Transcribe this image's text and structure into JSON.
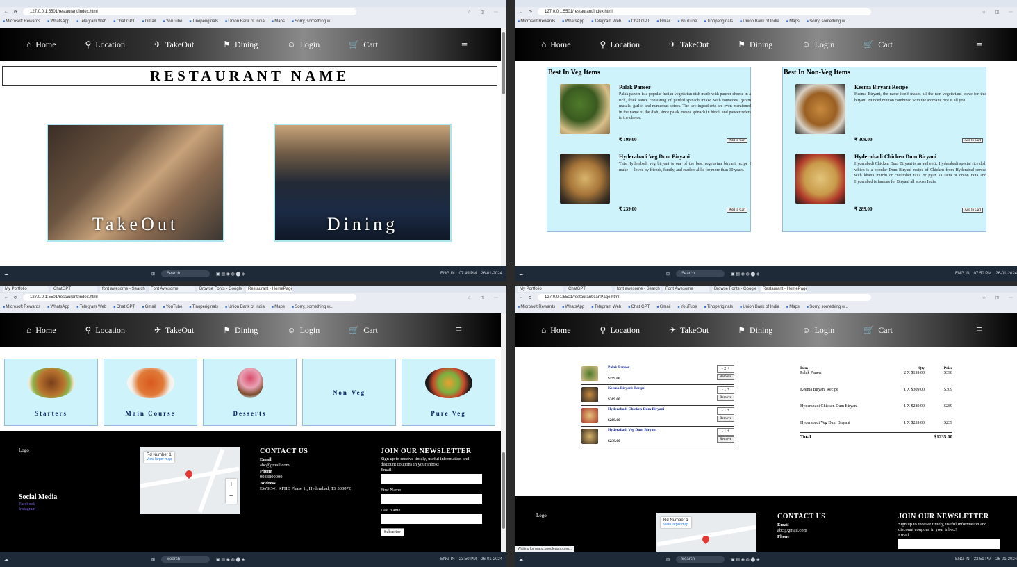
{
  "browser": {
    "url_home": "127.0.0.1:5501/restaurant/index.html",
    "url_cart": "127.0.0.1:5501/restaurant/cartPage.html",
    "bookmarks": [
      "Microsoft Rewards",
      "WhatsApp",
      "Telegram Web",
      "Chat GPT",
      "Gmail",
      "YouTube",
      "Tinoperiginals",
      "Union Bank of India",
      "Maps",
      "Sorry, something w..."
    ],
    "tabs": [
      "My Portfolio",
      "ChatGPT",
      "font awesome - Search",
      "Font Awesome",
      "Browse Fonts - Google F",
      "Restaurant - HomePage"
    ]
  },
  "nav": {
    "home": "Home",
    "location": "Location",
    "takeout": "TakeOut",
    "dining": "Dining",
    "login": "Login",
    "cart": "Cart",
    "menu_icon": "≡"
  },
  "home": {
    "restaurant_name": "RESTAURANT NAME",
    "takeout_label": "TakeOut",
    "dining_label": "Dining"
  },
  "menu": {
    "veg_title": "Best In Veg Items",
    "nonveg_title": "Best In Non-Veg Items",
    "add_label": "Add to Cart",
    "veg": [
      {
        "name": "Palak Paneer",
        "desc": "Palak paneer is a popular Indian vegetarian dish made with paneer cheese in a rich, thick sauce consisting of puréed spinach mixed with tomatoes, garam masala, garlic, and numerous spices. The key ingredients are even mentioned in the name of the dish, since palak means spinach in hindi, and paneer refers to the cheese.",
        "price": "₹ 199.00"
      },
      {
        "name": "Hyderabadi Veg Dum Biryani",
        "desc": "This Hyderabadi veg biryani is one of the best vegetarian biryani recipe I make — loved by friends, family, and readers alike for more than 10 years.",
        "price": "₹ 239.00"
      }
    ],
    "nonveg": [
      {
        "name": "Keema Biryani Recipe",
        "desc": "Keema Biryani, the name itself makes all the non vegetarians crave for this biryani. Minced mutton combined with the aromatic rice is all you!",
        "price": "₹ 309.00"
      },
      {
        "name": "Hyderabadi Chicken Dum Biryani",
        "desc": "Hyderabadi Chicken Dum Biryani is an authentic Hyderabadi special rice dish which is a popular Dum Biryani recipe of Chicken from Hyderabad served with khatta mirchi or cucumber raita or pyaz ka raita or onion raita and Hyderabad is famous for Biryani all across India.",
        "price": "₹ 289.00"
      }
    ]
  },
  "categories": [
    "Starters",
    "Main Course",
    "Desserts",
    "Non-Veg",
    "Pure Veg"
  ],
  "footer": {
    "logo": "Logo",
    "social_title": "Social Media",
    "social_links": [
      "Facebook",
      "Instagram"
    ],
    "map_place": "Rd Number 1",
    "map_link": "View larger map",
    "contact_title": "CONTACT US",
    "email_label": "Email",
    "email": "abc@gmail.com",
    "phone_label": "Phone",
    "phone": "9988800000",
    "address_label": "Address",
    "address": "EWS 341 KPHB Phase 1 , Hyderabad, TS 500072",
    "newsletter_title": "JOIN OUR NEWSLETTER",
    "newsletter_desc": "Sign up to receive timely, useful information and discount coupons in your inbox!",
    "email_field": "Email",
    "first_name": "First Name",
    "last_name": "Last Name",
    "subscribe": "Subscribe"
  },
  "cart": {
    "items": [
      {
        "name": "Palak Paneer",
        "price": "$199.00",
        "qty": "- 2 +",
        "remove": "Remove"
      },
      {
        "name": "Keema Biryani Recipe",
        "price": "$309.00",
        "qty": "- 1 +",
        "remove": "Remove"
      },
      {
        "name": "Hyderabadi Chicken Dum Biryani",
        "price": "$289.00",
        "qty": "- 1 +",
        "remove": "Remove"
      },
      {
        "name": "Hyderabadi Veg Dum Biryani",
        "price": "$239.00",
        "qty": "- 1 +",
        "remove": "Remove"
      }
    ],
    "summary_headers": [
      "Item",
      "Qty",
      "Price"
    ],
    "summary_rows": [
      [
        "Palak Paneer",
        "2 X $199.00",
        "$398"
      ],
      [
        "Keema Biryani Recipe",
        "1 X $309.00",
        "$309"
      ],
      [
        "Hyderabadi Chicken Dum Biryani",
        "1 X $289.00",
        "$289"
      ],
      [
        "Hyderabadi Veg Dum Biryani",
        "1 X $239.00",
        "$239"
      ]
    ],
    "total_label": "Total",
    "total_value": "$1235.00",
    "status": "Waiting for maps.googleapis.com..."
  },
  "taskbar": {
    "search": "Search",
    "time1": "07:49 PM",
    "time2": "07:50 PM",
    "time3": "23:50 PM",
    "time4": "23:51 PM",
    "date": "26-01-2024",
    "lang": "ENG IN"
  }
}
